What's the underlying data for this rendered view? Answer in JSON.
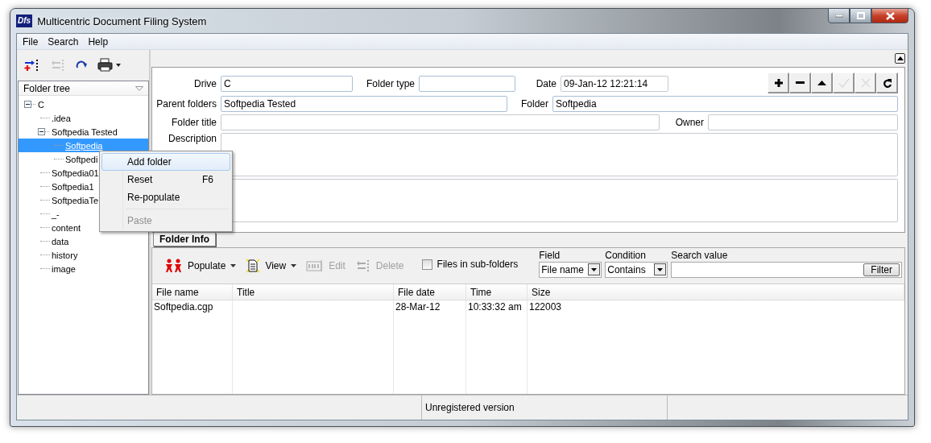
{
  "window": {
    "logo": "Dfs",
    "title": "Multicentric Document Filing System",
    "controls": [
      {
        "kind": "minimize"
      },
      {
        "kind": "maximize"
      },
      {
        "kind": "close"
      }
    ]
  },
  "menu_bar": [
    "File",
    "Search",
    "Help"
  ],
  "tree_toolbar": [
    {
      "kind": "add",
      "disabled": false
    },
    {
      "kind": "remove",
      "disabled": true
    },
    {
      "kind": "redo",
      "disabled": false
    },
    {
      "kind": "print",
      "disabled": false
    }
  ],
  "folder_tree": {
    "header": "Folder tree",
    "items": [
      {
        "label": "C",
        "expanded": true,
        "selected": false,
        "children": [
          {
            "label": ".idea",
            "selected": false
          },
          {
            "label": "Softpedia Tested",
            "expanded": true,
            "selected": false,
            "children": [
              {
                "label": "Softpedia",
                "selected": true
              },
              {
                "label": "Softpedi",
                "selected": false
              }
            ]
          },
          {
            "label": "Softpedia01",
            "selected": false
          },
          {
            "label": "Softpedia1",
            "selected": false
          },
          {
            "label": "SoftpediaTe",
            "selected": false
          },
          {
            "label": "_-",
            "selected": false
          },
          {
            "label": "content",
            "selected": false
          },
          {
            "label": "data",
            "selected": false
          },
          {
            "label": "history",
            "selected": false
          },
          {
            "label": "image",
            "selected": false
          }
        ]
      }
    ]
  },
  "context_menu": [
    {
      "kind": "item",
      "label": "Add folder",
      "selected": true,
      "disabled": false
    },
    {
      "kind": "item",
      "label": "Reset",
      "shortcut": "F6",
      "selected": false,
      "disabled": false
    },
    {
      "kind": "item",
      "label": "Re-populate",
      "selected": false,
      "disabled": false
    },
    {
      "kind": "separator"
    },
    {
      "kind": "item",
      "label": "Paste",
      "selected": false,
      "disabled": true
    }
  ],
  "folder_form": {
    "fields": [
      {
        "label": "Drive",
        "value": "C"
      },
      {
        "label": "Folder type"
      },
      {
        "label": "Date",
        "value": "09-Jan-12 12:21:14"
      },
      {
        "label": "Parent folders",
        "value": "Softpedia Tested"
      },
      {
        "label": "Folder",
        "value": "Softpedia"
      },
      {
        "label": "Folder title"
      },
      {
        "label": "Owner"
      },
      {
        "label": "Description"
      }
    ],
    "record_buttons": [
      {
        "kind": "add",
        "disabled": false
      },
      {
        "kind": "remove",
        "disabled": false
      },
      {
        "kind": "up",
        "disabled": false
      },
      {
        "kind": "confirm",
        "disabled": true
      },
      {
        "kind": "cancel",
        "disabled": true
      },
      {
        "kind": "refresh",
        "disabled": false
      }
    ]
  },
  "tabs": [
    {
      "label": "Folder Info",
      "selected": true
    }
  ],
  "file_toolbar": {
    "buttons": [
      {
        "kind": "populate",
        "label": "Populate",
        "dropdown": true,
        "disabled": false
      },
      {
        "kind": "view",
        "label": "View",
        "dropdown": true,
        "disabled": false
      },
      {
        "kind": "edit",
        "label": "Edit",
        "dropdown": false,
        "disabled": true
      },
      {
        "kind": "delete",
        "label": "Delete",
        "dropdown": false,
        "disabled": true
      }
    ],
    "subfolders": {
      "label": "Files in sub-folders",
      "checked": false
    },
    "field": {
      "label": "Field",
      "value": "File name"
    },
    "condition": {
      "label": "Condition",
      "value": "Contains"
    },
    "search": {
      "label": "Search value"
    },
    "filter_button": "Filter"
  },
  "files_table": {
    "columns": [
      "File name",
      "Title",
      "File date",
      "Time",
      "Size"
    ],
    "rows": [
      {
        "cells": [
          "Softpedia.cgp",
          null,
          "28-Mar-12",
          "10:33:32 am",
          "122003"
        ]
      }
    ]
  },
  "status_bar": {
    "message": "Unregistered version"
  }
}
